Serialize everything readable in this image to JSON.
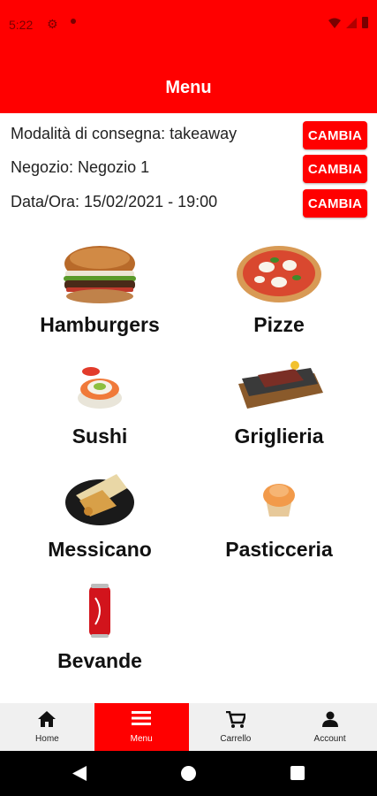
{
  "status": {
    "time": "5:22"
  },
  "appbar": {
    "title": "Menu"
  },
  "info": [
    {
      "text": "Modalità di consegna: takeaway",
      "button": "CAMBIA"
    },
    {
      "text": "Negozio: Negozio 1",
      "button": "CAMBIA"
    },
    {
      "text": "Data/Ora: 15/02/2021 - 19:00",
      "button": "CAMBIA"
    }
  ],
  "categories": [
    {
      "label": "Hamburgers",
      "icon": "hamburger-image"
    },
    {
      "label": "Pizze",
      "icon": "pizza-image"
    },
    {
      "label": "Sushi",
      "icon": "sushi-image"
    },
    {
      "label": "Griglieria",
      "icon": "grill-image"
    },
    {
      "label": "Messicano",
      "icon": "mexican-image"
    },
    {
      "label": "Pasticceria",
      "icon": "pastry-image"
    },
    {
      "label": "Bevande",
      "icon": "drink-image"
    }
  ],
  "bottomnav": [
    {
      "label": "Home",
      "icon": "home-icon",
      "active": false
    },
    {
      "label": "Menu",
      "icon": "menu-icon",
      "active": true
    },
    {
      "label": "Carrello",
      "icon": "cart-icon",
      "active": false
    },
    {
      "label": "Account",
      "icon": "account-icon",
      "active": false
    }
  ],
  "colors": {
    "accent": "#ff0000",
    "navbar_bg": "#f0f0f0"
  }
}
